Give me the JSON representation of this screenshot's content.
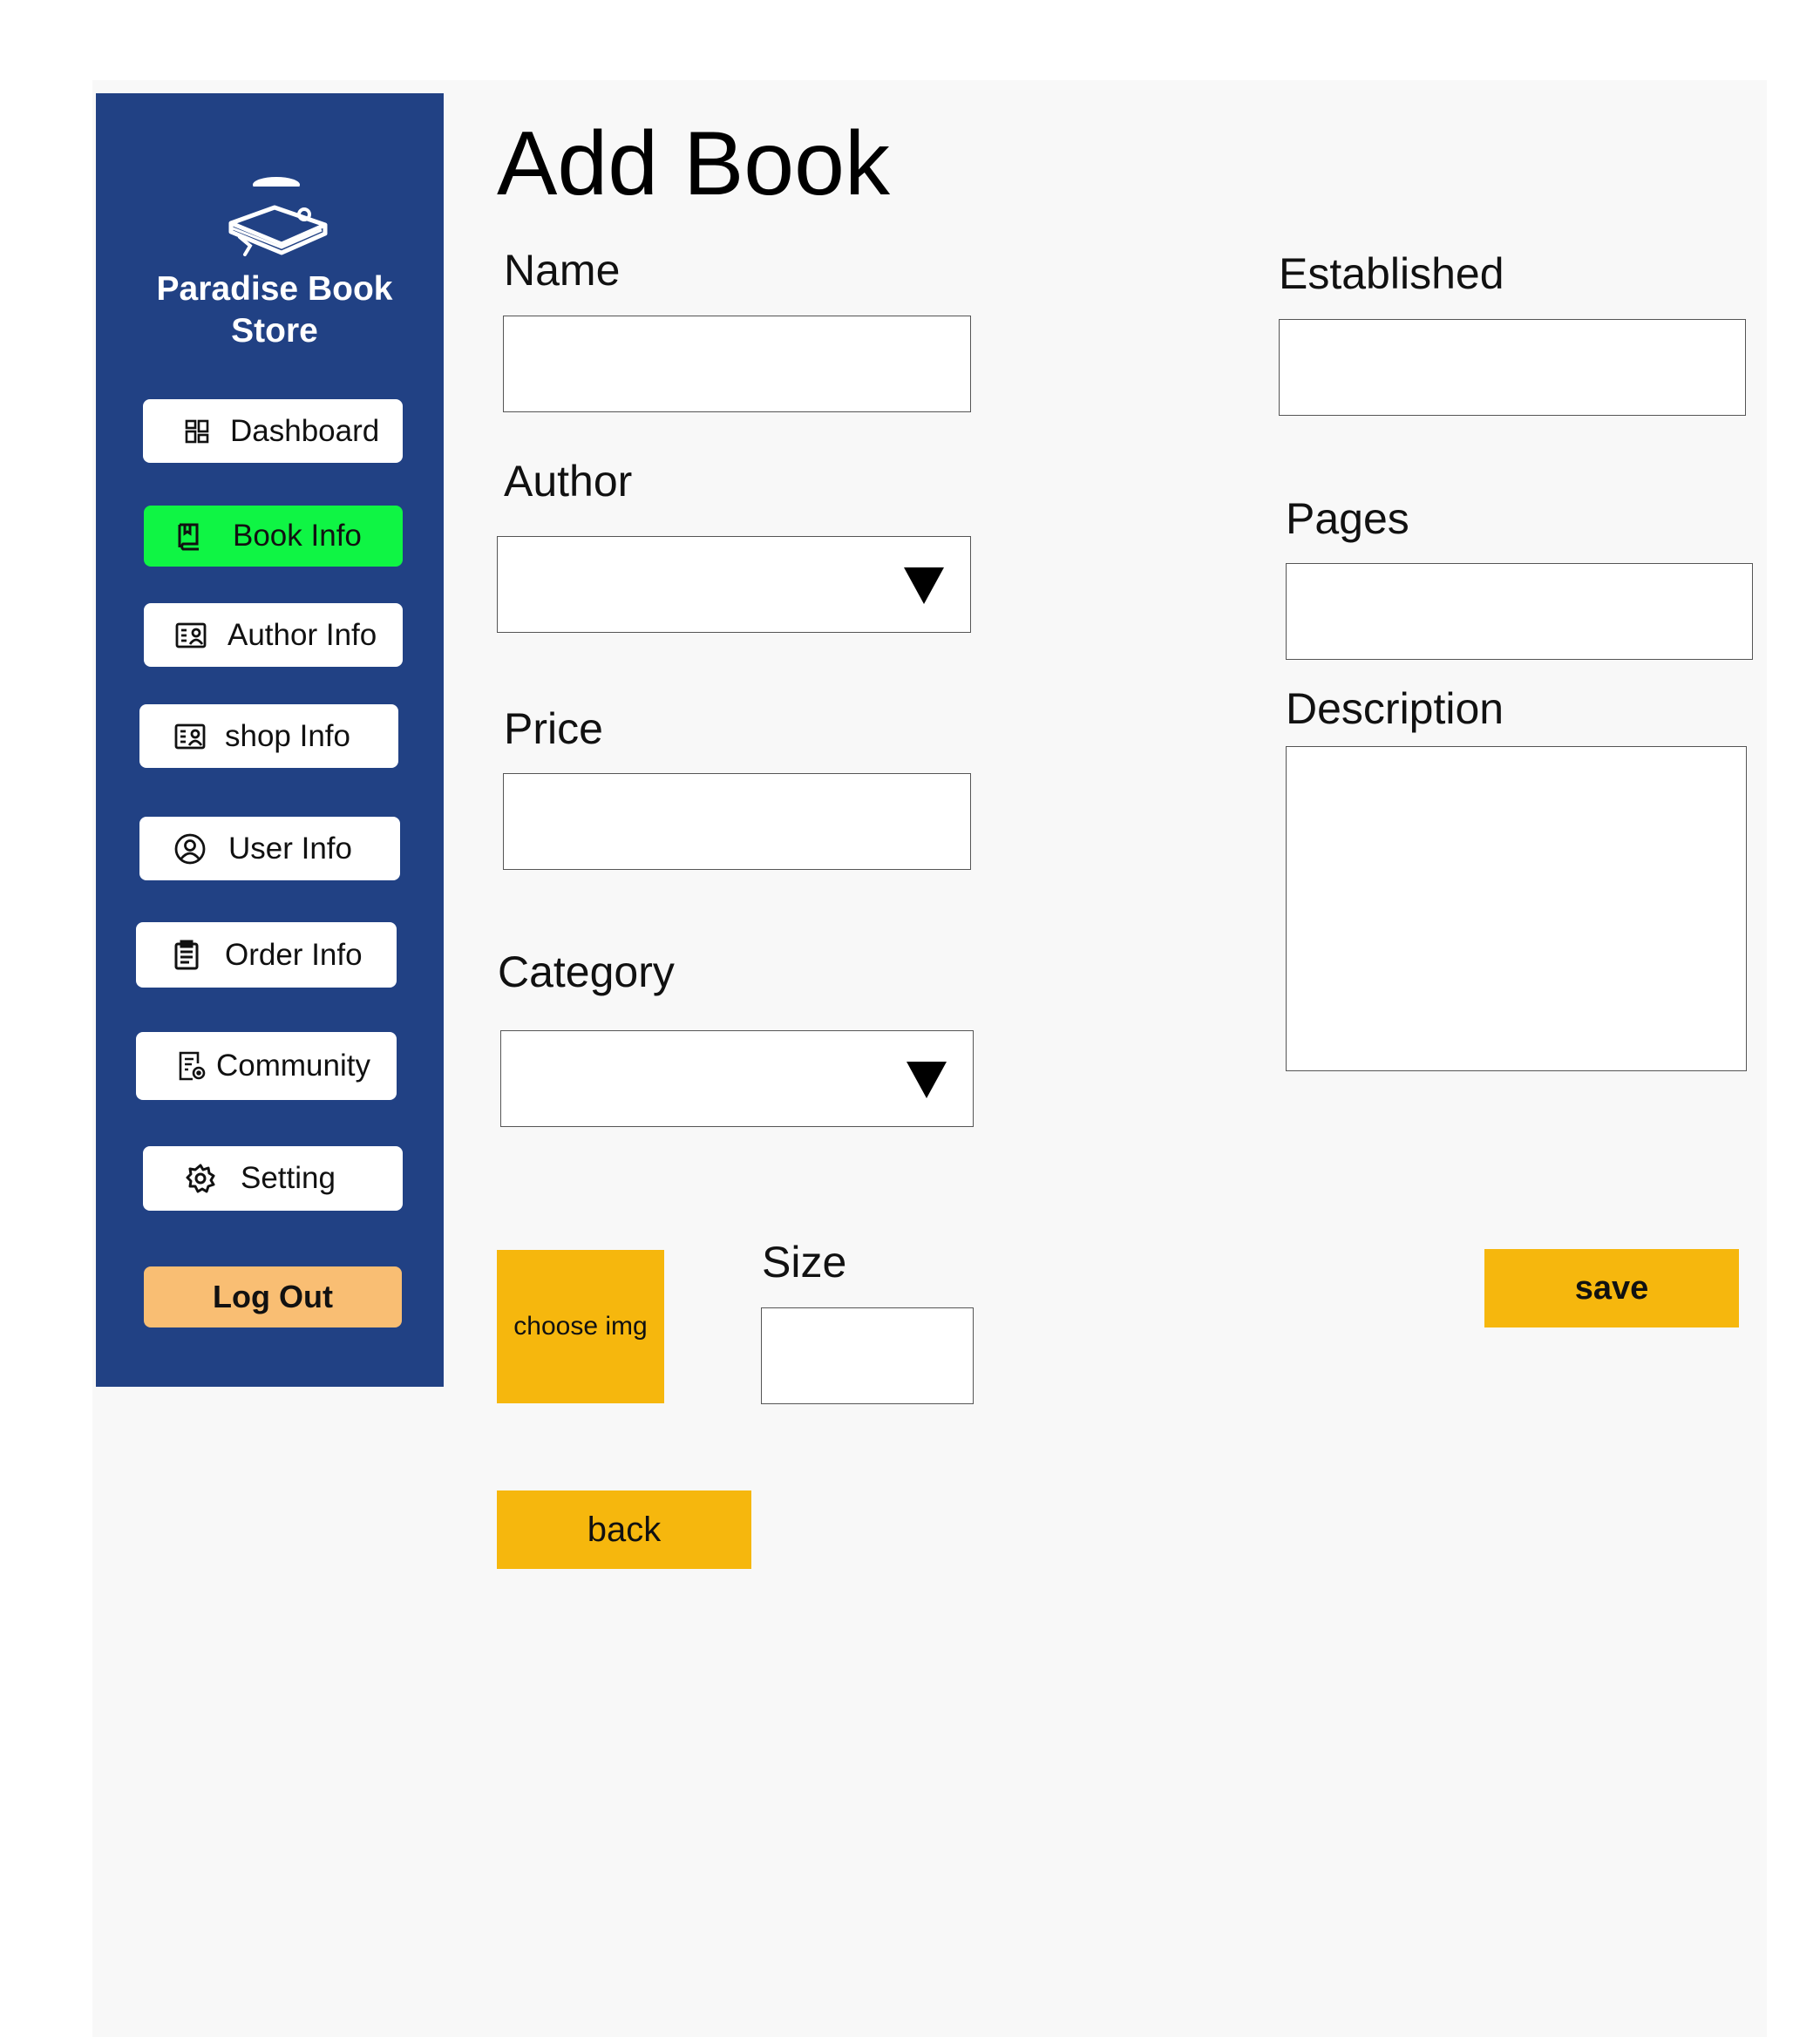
{
  "sidebar": {
    "brand_name": "Paradise Book Store",
    "logo_icon": "book-stack-logo-icon",
    "items": [
      {
        "label": "Dashboard",
        "icon": "dashboard-icon",
        "active": false
      },
      {
        "label": "Book Info",
        "icon": "book-icon",
        "active": true
      },
      {
        "label": "Author Info",
        "icon": "id-card-icon",
        "active": false
      },
      {
        "label": "shop Info",
        "icon": "id-card-icon",
        "active": false
      },
      {
        "label": "User Info",
        "icon": "user-circle-icon",
        "active": false
      },
      {
        "label": "Order Info",
        "icon": "clipboard-icon",
        "active": false
      },
      {
        "label": "Community",
        "icon": "document-settings-icon",
        "active": false
      },
      {
        "label": "Setting",
        "icon": "gear-icon",
        "active": false
      }
    ],
    "logout_label": "Log Out",
    "colors": {
      "background": "#214184",
      "active_item": "#0ff544",
      "logout": "#f9be73"
    }
  },
  "page": {
    "title": "Add Book"
  },
  "form": {
    "name": {
      "label": "Name",
      "value": ""
    },
    "author": {
      "label": "Author",
      "value": ""
    },
    "price": {
      "label": "Price",
      "value": ""
    },
    "category": {
      "label": "Category",
      "value": ""
    },
    "established": {
      "label": "Established",
      "value": ""
    },
    "pages": {
      "label": "Pages",
      "value": ""
    },
    "description": {
      "label": "Description",
      "value": ""
    },
    "size": {
      "label": "Size",
      "value": ""
    },
    "choose_img_label": "choose img",
    "save_label": "save",
    "back_label": "back",
    "accent_color": "#f6b70d"
  }
}
